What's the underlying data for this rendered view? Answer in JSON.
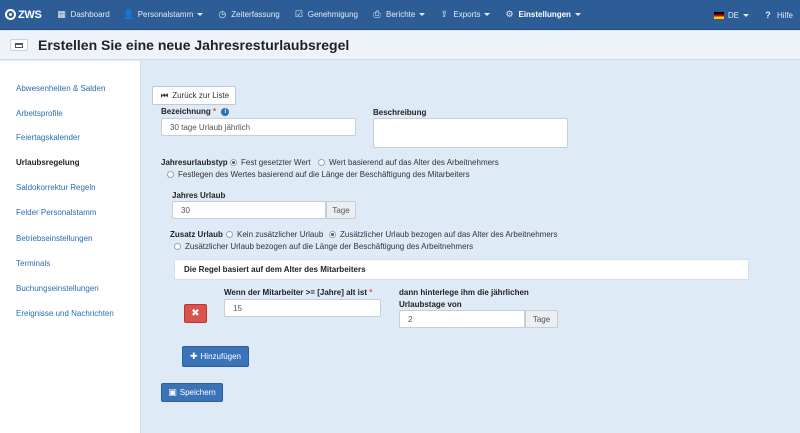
{
  "nav": {
    "brand": "ZWS",
    "items": [
      {
        "label": "Dashboard",
        "icon": "grid-icon",
        "glyph": "▦"
      },
      {
        "label": "Personalstamm",
        "icon": "user-icon",
        "glyph": "👤"
      },
      {
        "label": "Zeiterfassung",
        "icon": "clock-icon",
        "glyph": "◷"
      },
      {
        "label": "Genehmigung",
        "icon": "checkbox-icon",
        "glyph": "☑"
      },
      {
        "label": "Berichte",
        "icon": "printer-icon",
        "glyph": "⎙"
      },
      {
        "label": "Exports",
        "icon": "upload-icon",
        "glyph": "⇪"
      },
      {
        "label": "Einstellungen",
        "icon": "gear-icon",
        "glyph": "⚙"
      }
    ],
    "language": "DE",
    "help": "Hilfe",
    "help_glyph": "?"
  },
  "page": {
    "title": "Erstellen Sie eine neue Jahresresturlaubsregel"
  },
  "sidebar": {
    "items": [
      "Abwesenheiten & Salden",
      "Arbeitsprofile",
      "Feiertagskalender",
      "Urlaubsregelung",
      "Saldokorrektur Regeln",
      "Felder Personalstamm",
      "Betriebseinstellungen",
      "Terminals",
      "Buchungseinstellungen",
      "Ereignisse und Nachrichten"
    ],
    "active": "Urlaubsregelung"
  },
  "form": {
    "back_label": "Zurück zur Liste",
    "bezeichnung_label": "Bezeichnung",
    "required_mark": "*",
    "info_glyph": "i",
    "bezeichnung_value": "30 tage Urlaub jährlich",
    "beschreibung_label": "Beschreibung",
    "beschreibung_value": "",
    "typ_label": "Jahresurlaubstyp",
    "typ_options": [
      "Fest gesetzter Wert",
      "Wert basierend auf das Alter des Arbeitnehmers",
      "Festlegen des Wertes basierend auf die Länge der Beschäftigung des Mitarbeiters"
    ],
    "typ_selected": "Fest gesetzter Wert",
    "jahres_label": "Jahres Urlaub",
    "jahres_value": "30",
    "tage_addon": "Tage",
    "zusatz_label": "Zusatz Urlaub",
    "zusatz_options": [
      "Kein zusätzlicher Urlaub",
      "Zusätzlicher Urlaub bezogen auf das Alter des Arbeitnehmers",
      "Zusätzlicher Urlaub bezogen auf die Länge der Beschäftigung des Arbeitnehmers"
    ],
    "zusatz_selected": "Zusätzlicher Urlaub bezogen auf das Alter des Arbeitnehmers",
    "rule": {
      "heading": "Die Regel basiert auf dem Alter des Mitarbeiters",
      "age_label": "Wenn der Mitarbeiter >= [Jahre] alt ist",
      "age_value": "15",
      "days_label_line1": "dann hinterlege ihm die jährlichen",
      "days_label_line2": "Urlaubstage von",
      "days_value": "2",
      "delete_glyph": "✖"
    },
    "add_label": "Hinzufügen",
    "add_glyph": "✚",
    "save_label": "Speichern",
    "save_glyph": "▣"
  }
}
